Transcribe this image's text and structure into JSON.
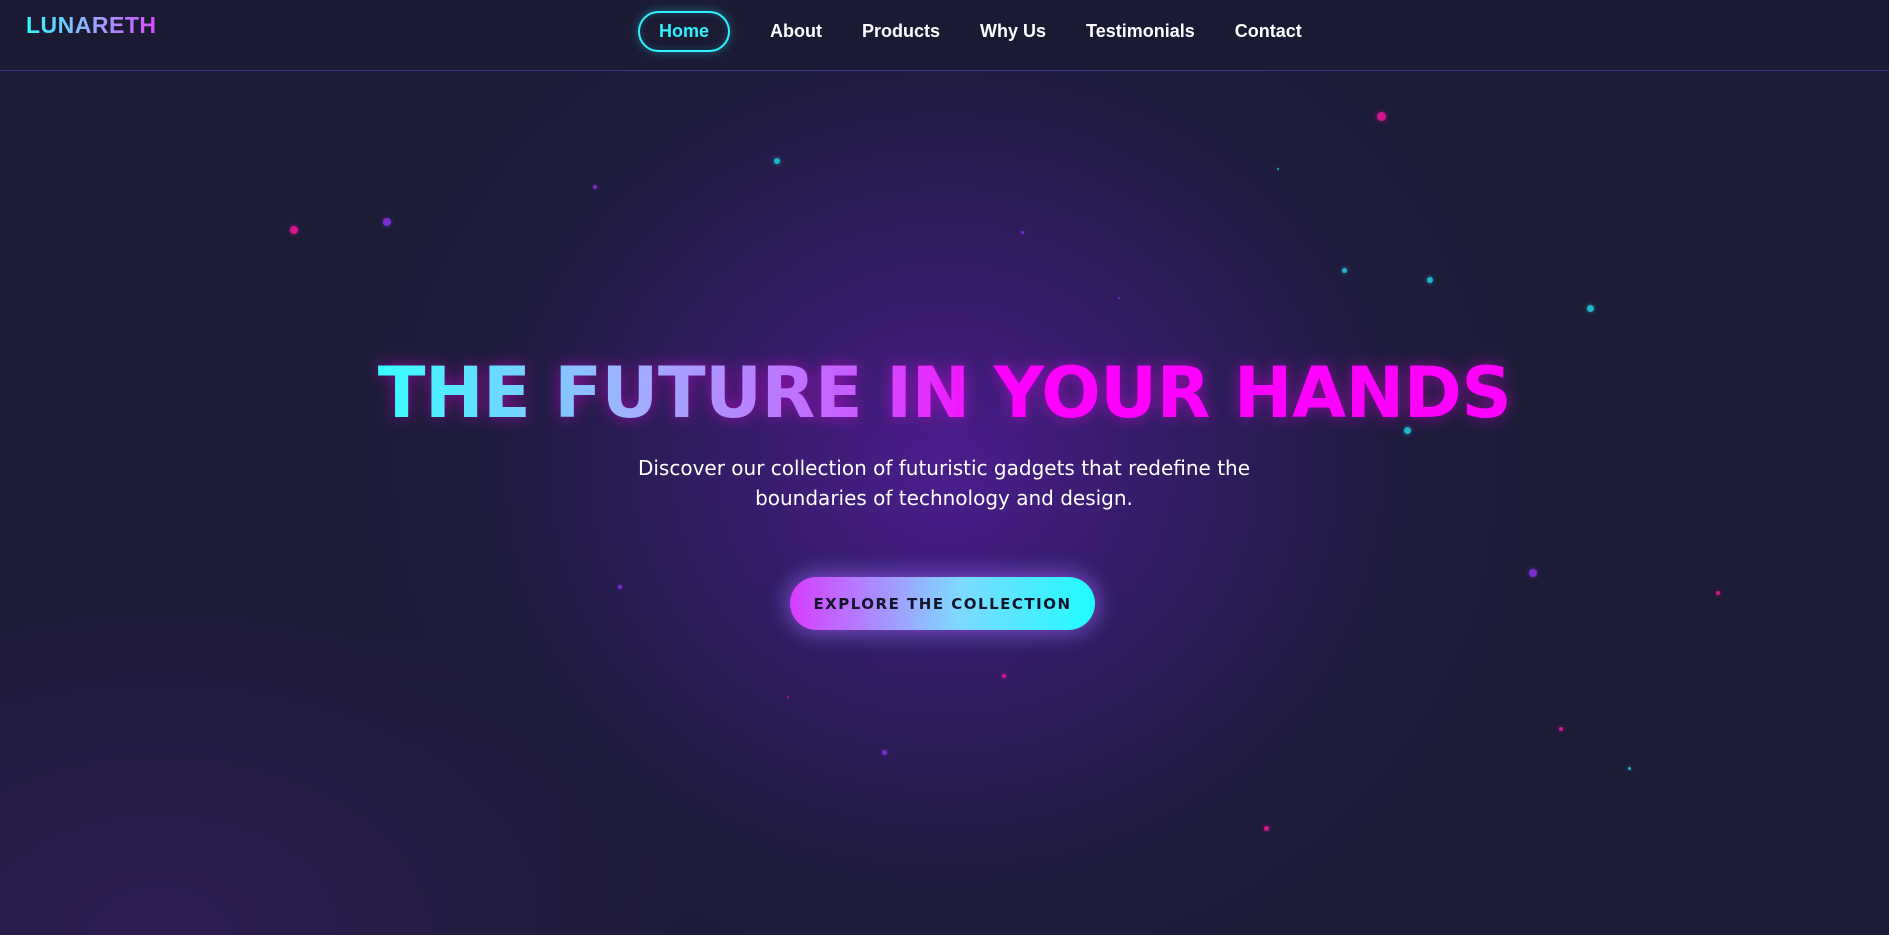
{
  "brand": {
    "logo": "LUNARETH"
  },
  "nav": {
    "items": [
      {
        "label": "Home",
        "active": true
      },
      {
        "label": "About",
        "active": false
      },
      {
        "label": "Products",
        "active": false
      },
      {
        "label": "Why Us",
        "active": false
      },
      {
        "label": "Testimonials",
        "active": false
      },
      {
        "label": "Contact",
        "active": false
      }
    ]
  },
  "hero": {
    "title": "THE FUTURE IN YOUR HANDS",
    "subtitle": "Discover our collection of futuristic gadgets that redefine the boundaries of technology and design.",
    "cta_label": "EXPLORE THE COLLECTION"
  },
  "colors": {
    "background": "#1c1c36",
    "accent_cyan": "#2ff3ff",
    "accent_magenta": "#ff00ff",
    "accent_purple": "#7a2ed0"
  }
}
